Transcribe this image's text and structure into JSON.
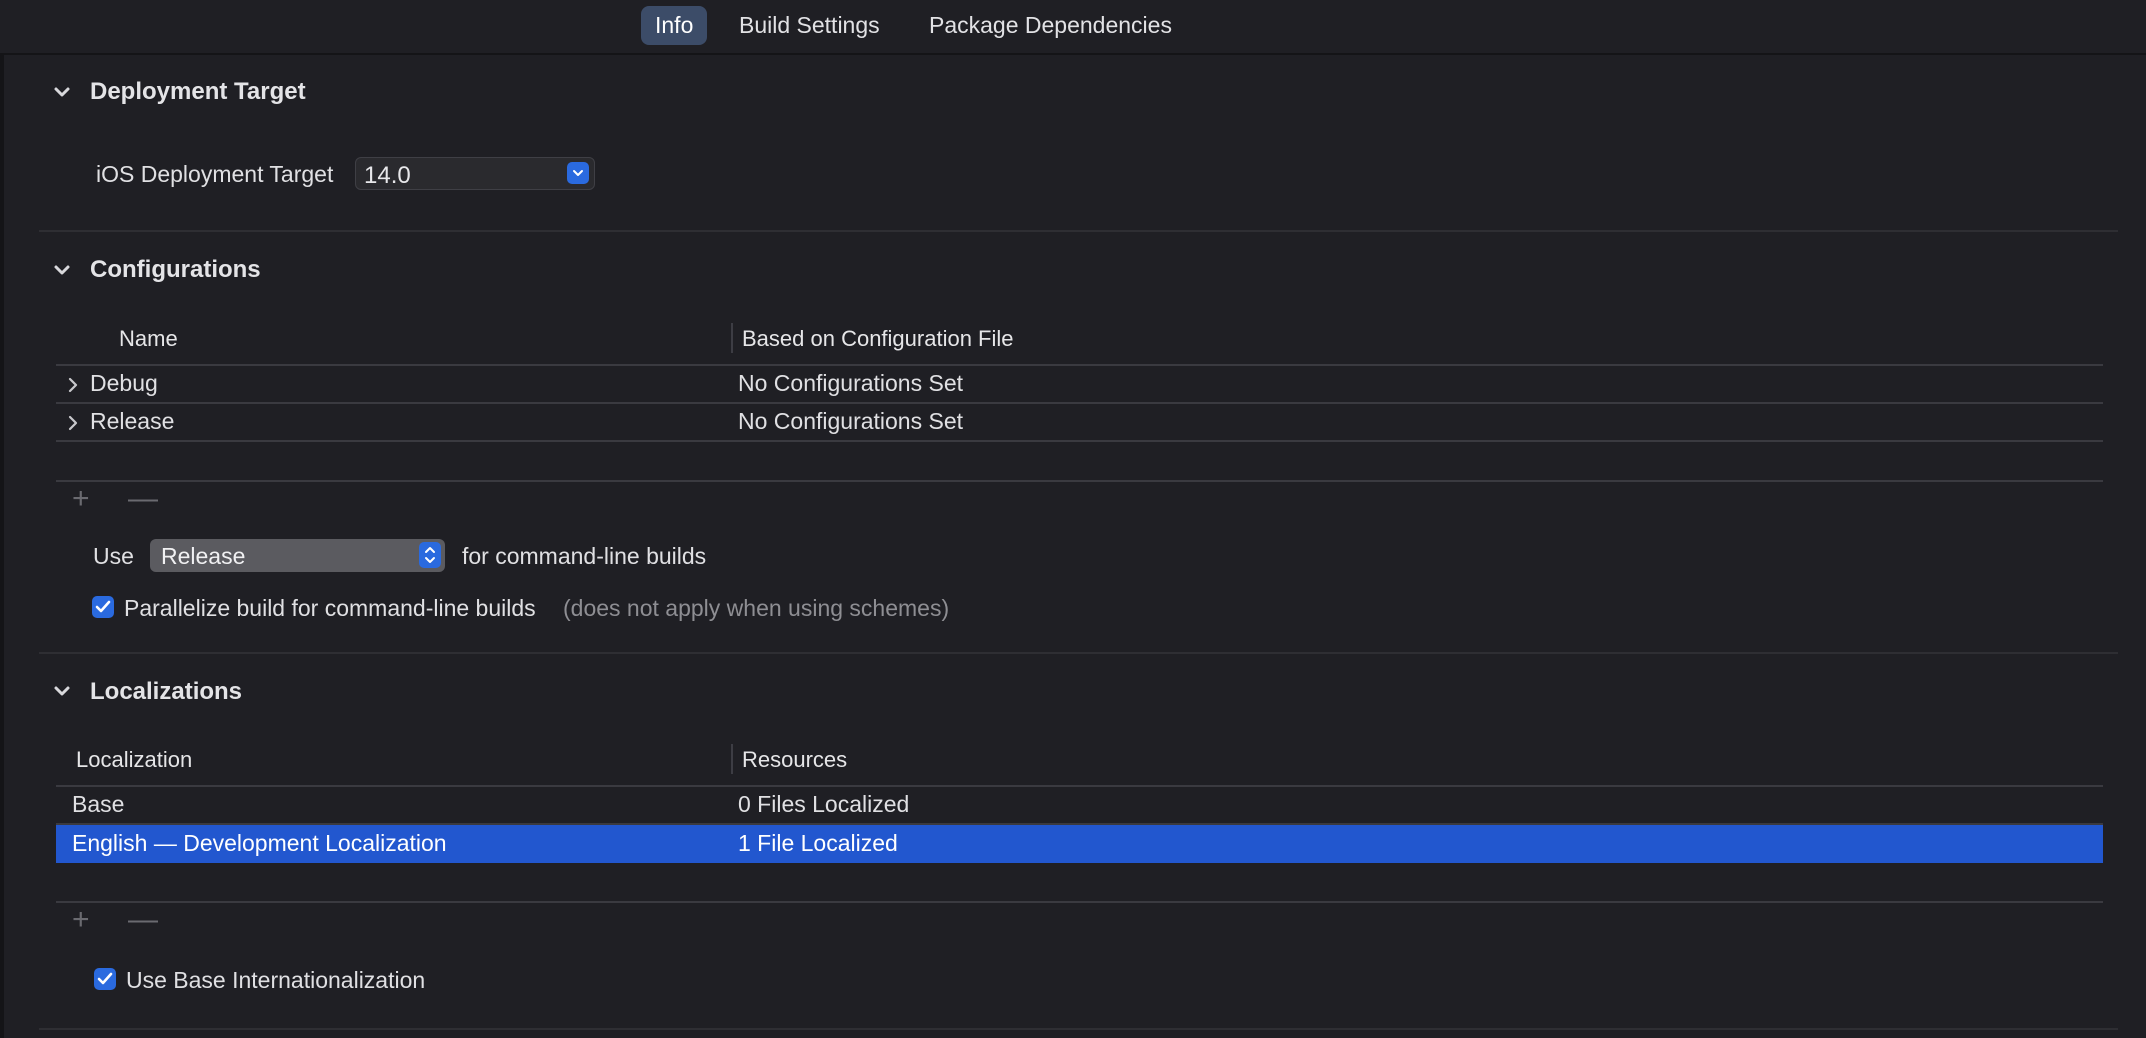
{
  "tabs": [
    {
      "label": "Info",
      "active": true
    },
    {
      "label": "Build Settings",
      "active": false
    },
    {
      "label": "Package Dependencies",
      "active": false
    }
  ],
  "deployment": {
    "title": "Deployment Target",
    "ios_label": "iOS Deployment Target",
    "ios_value": "14.0"
  },
  "configurations": {
    "title": "Configurations",
    "headers": [
      "Name",
      "Based on Configuration File"
    ],
    "rows": [
      {
        "name": "Debug",
        "file": "No Configurations Set"
      },
      {
        "name": "Release",
        "file": "No Configurations Set"
      }
    ],
    "add": "+",
    "remove": "—",
    "use_label": "Use",
    "use_value": "Release",
    "use_suffix": "for command-line builds",
    "parallelize_label": "Parallelize build for command-line builds",
    "parallelize_note": "(does not apply when using schemes)",
    "parallelize_checked": true
  },
  "localizations": {
    "title": "Localizations",
    "headers": [
      "Localization",
      "Resources"
    ],
    "rows": [
      {
        "name": "Base",
        "resources": "0 Files Localized",
        "selected": false
      },
      {
        "name": "English — Development Localization",
        "resources": "1 File Localized",
        "selected": true
      }
    ],
    "add": "+",
    "remove": "—",
    "base_intl_label": "Use Base Internationalization",
    "base_intl_checked": true
  },
  "colors": {
    "accent": "#2a6adf",
    "selection": "#2257cf",
    "background": "#1f1f24",
    "active_tab": "#3c4c68"
  }
}
